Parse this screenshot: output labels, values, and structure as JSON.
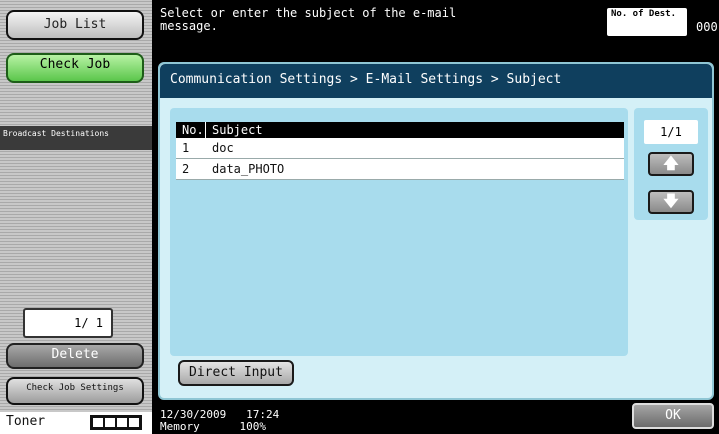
{
  "left": {
    "job_list": "Job List",
    "check_job": "Check Job",
    "broadcast": "Broadcast Destinations",
    "page": "1/ 1",
    "delete": "Delete",
    "check_job_settings": "Check Job Settings",
    "toner_label": "Toner",
    "toner_level": 1.0
  },
  "top": {
    "message": "Select or enter  the subject of the e-mail message.",
    "dest_label": "No. of Dest.",
    "dest_count": "000"
  },
  "main": {
    "breadcrumb": "Communication Settings > E-Mail Settings > Subject",
    "table": {
      "headers": [
        "No.",
        "Subject"
      ],
      "rows": [
        {
          "no": "1",
          "subject": "doc"
        },
        {
          "no": "2",
          "subject": "data_PHOTO"
        }
      ]
    },
    "scroll_page": "1/1",
    "up_icon": "arrow-up-icon",
    "down_icon": "arrow-down-icon",
    "direct_input": "Direct Input"
  },
  "bottom": {
    "datetime": "12/30/2009   17:24",
    "memory": "Memory      100%",
    "ok": "OK"
  },
  "colors": {
    "title_bar": "#0f3f5e",
    "window_bg": "#d4f0f7",
    "panel_bg": "#a8dced",
    "check_job_green": "#5bc64b"
  }
}
